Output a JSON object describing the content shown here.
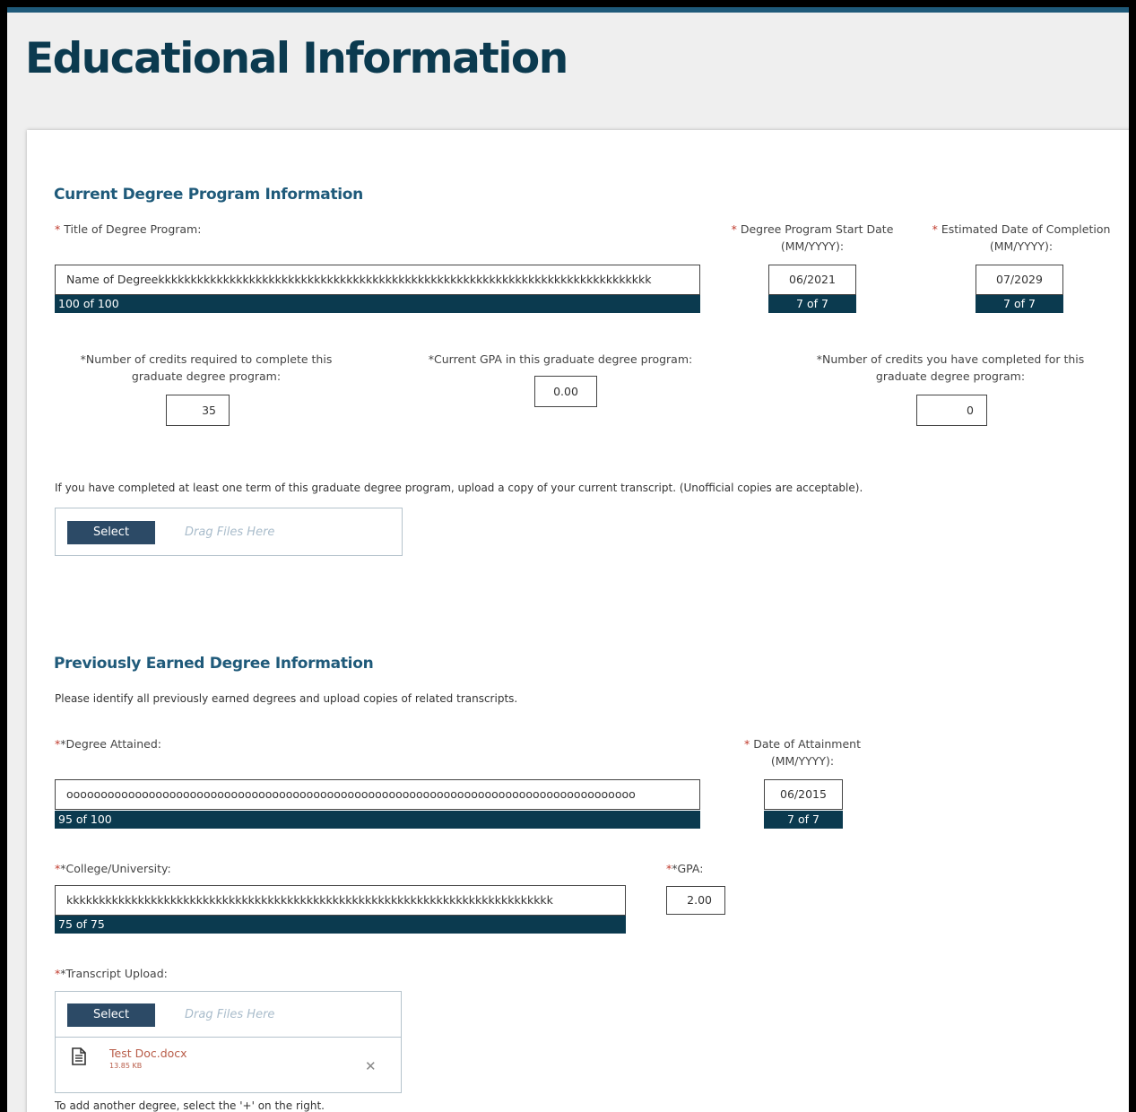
{
  "page": {
    "title": "Educational Information"
  },
  "current": {
    "section_title": "Current Degree Program Information",
    "title_label": "Title of Degree Program:",
    "title_value": "Name of Degreekkkkkkkkkkkkkkkkkkkkkkkkkkkkkkkkkkkkkkkkkkkkkkkkkkkkkkkkkkkkkkkkkkkkkkkkkkkk",
    "title_counter": "100 of 100",
    "start_label_1": "Degree Program Start Date",
    "start_label_2": "(MM/YYYY):",
    "start_value": "06/2021",
    "start_counter": "7 of 7",
    "completion_label_1": "Estimated Date of Completion",
    "completion_label_2": "(MM/YYYY):",
    "completion_value": "07/2029",
    "completion_counter": "7 of 7",
    "credits_required_label_1": "*Number of credits required to complete this",
    "credits_required_label_2": "graduate degree program:",
    "credits_required_value": "35",
    "gpa_label": "*Current GPA in this graduate degree program:",
    "gpa_value": "0.00",
    "credits_completed_label_1": "*Number of credits you have completed for this",
    "credits_completed_label_2": "graduate degree program:",
    "credits_completed_value": "0",
    "transcript_note": "If you have completed at least one term of this graduate degree program, upload a copy of your current transcript. (Unofficial copies are acceptable).",
    "select_label": "Select",
    "drag_label": "Drag Files Here"
  },
  "previous": {
    "section_title": "Previously Earned Degree Information",
    "instructions": "Please identify all previously earned degrees and upload copies of related transcripts.",
    "degree_label": "*Degree Attained:",
    "degree_value": "ooooooooooooooooooooooooooooooooooooooooooooooooooooooooooooooooooooooooooooooooooo",
    "degree_counter": "95 of 100",
    "date_label_1": "Date of Attainment",
    "date_label_2": "(MM/YYYY):",
    "date_value": "06/2015",
    "date_counter": "7 of 7",
    "college_label": "*College/University:",
    "college_value": "kkkkkkkkkkkkkkkkkkkkkkkkkkkkkkkkkkkkkkkkkkkkkkkkkkkkkkkkkkkkkkkkkkkkkkkkkkk",
    "college_counter": "75 of 75",
    "gpa_label": "*GPA:",
    "gpa_value": "2.00",
    "transcript_label": "*Transcript Upload:",
    "select_label": "Select",
    "drag_label": "Drag Files Here",
    "file_name": "Test Doc.docx",
    "file_size": "13.85 KB",
    "add_note": "To add another degree, select the '+' on the right."
  },
  "icons": {
    "file": "document-icon",
    "remove": "close-icon"
  },
  "colors": {
    "accent": "#1f5a7a",
    "counter_bg": "#0b3a4f",
    "button_bg": "#2c4a66",
    "required": "#c0392b",
    "file_text": "#b85c48"
  }
}
